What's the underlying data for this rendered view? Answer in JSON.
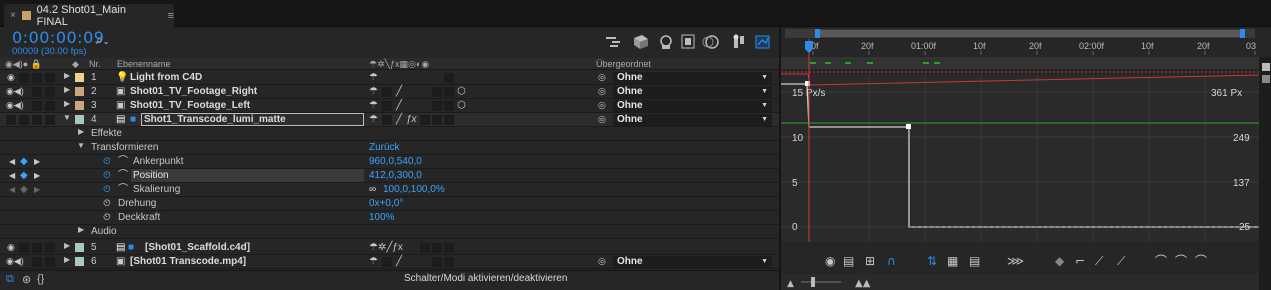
{
  "tab": {
    "close": "×",
    "title": "04.2 Shot01_Main FINAL",
    "menu": "≡"
  },
  "timecode": {
    "time": "0:00:00:09",
    "frames": "00009 (30.00 fps)"
  },
  "search": {
    "icon": "search-icon",
    "caret": "⌄"
  },
  "toolbar_icons": [
    "comp-flowchart-icon",
    "draft-3d-icon",
    "shy-layers-icon",
    "frame-blending-icon",
    "motion-blur-icon",
    "graph-editor-icon",
    "brainstorm-icon"
  ],
  "columns": {
    "nr": "Nr.",
    "layer": "Ebenenname",
    "parent": "Übergeordnet"
  },
  "layers": [
    {
      "nr": "1",
      "name": "Light from C4D",
      "parent": "Ohne",
      "color": "#f2d28b"
    },
    {
      "nr": "2",
      "name": "Shot01_TV_Footage_Right",
      "parent": "Ohne",
      "color": "#c8a67e"
    },
    {
      "nr": "3",
      "name": "Shot01_TV_Footage_Left",
      "parent": "Ohne",
      "color": "#c8a67e"
    },
    {
      "nr": "4",
      "name": "Shot1_Transcode_lumi_matte",
      "parent": "Ohne",
      "color": "#a7c8c3"
    },
    {
      "nr": "5",
      "name": "[Shot01_Scaffold.c4d]",
      "parent": "",
      "color": "#a7c8c3"
    },
    {
      "nr": "6",
      "name": "[Shot01 Transcode.mp4]",
      "parent": "Ohne",
      "color": "#a7c8c3"
    }
  ],
  "props": {
    "effekte": "Effekte",
    "transform": "Transformieren",
    "reset": "Zurück",
    "anchor": {
      "label": "Ankerpunkt",
      "value": "960,0,540,0"
    },
    "position": {
      "label": "Position",
      "value": "412,0,300,0"
    },
    "scale": {
      "label": "Skalierung",
      "value": "100,0,100,0%"
    },
    "rotation": {
      "label": "Drehung",
      "value": "0x+0,0°"
    },
    "opacity": {
      "label": "Deckkraft",
      "value": "100%"
    },
    "audio": "Audio"
  },
  "bottom": {
    "toggle": "Schalter/Modi aktivieren/deaktivieren"
  },
  "ruler": [
    "0f",
    "20f",
    "01:00f",
    "10f",
    "20f",
    "02:00f",
    "10f",
    "20f",
    "03"
  ],
  "graph": {
    "speed_label": "15 Px/s",
    "y_labels": [
      "10",
      "5",
      "0"
    ],
    "right_labels": [
      "361 Px",
      "249",
      "137",
      "25"
    ]
  }
}
